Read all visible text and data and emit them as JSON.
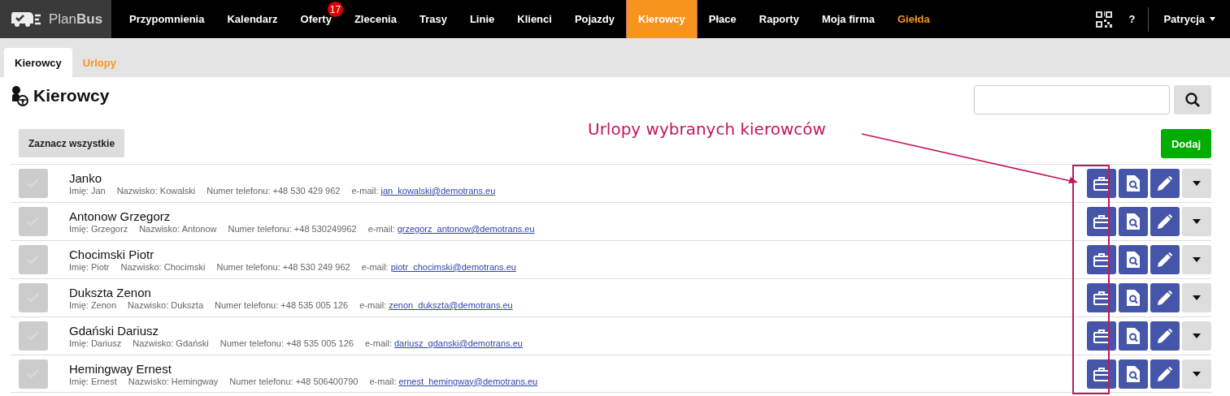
{
  "brand": {
    "name_light": "Plan",
    "name_bold": "Bus"
  },
  "nav": [
    {
      "label": "Przypomnienia",
      "selected": false,
      "accent": false
    },
    {
      "label": "Kalendarz",
      "selected": false,
      "accent": false
    },
    {
      "label": "Oferty",
      "selected": false,
      "accent": false,
      "badge": "17"
    },
    {
      "label": "Zlecenia",
      "selected": false,
      "accent": false
    },
    {
      "label": "Trasy",
      "selected": false,
      "accent": false
    },
    {
      "label": "Linie",
      "selected": false,
      "accent": false
    },
    {
      "label": "Klienci",
      "selected": false,
      "accent": false
    },
    {
      "label": "Pojazdy",
      "selected": false,
      "accent": false
    },
    {
      "label": "Kierowcy",
      "selected": true,
      "accent": false
    },
    {
      "label": "Płace",
      "selected": false,
      "accent": false
    },
    {
      "label": "Raporty",
      "selected": false,
      "accent": false
    },
    {
      "label": "Moja firma",
      "selected": false,
      "accent": false
    },
    {
      "label": "Giełda",
      "selected": false,
      "accent": true
    }
  ],
  "help": "?",
  "user": "Patrycja",
  "tabs": [
    {
      "label": "Kierowcy",
      "selected": true
    },
    {
      "label": "Urlopy",
      "selected": false
    }
  ],
  "page_title": "Kierowcy",
  "select_all": "Zaznacz wszystkie",
  "add": "Dodaj",
  "annotation": "Urlopy wybranych kierowców",
  "drivers": [
    {
      "name": "Janko",
      "first": "Imię: Jan",
      "last": "Nazwisko: Kowalski",
      "phone": "Numer telefonu: +48 530 429 962",
      "email_label": "e-mail:",
      "email": "jan_kowalski@demotrans.eu",
      "checked": false
    },
    {
      "name": "Antonow Grzegorz",
      "first": "Imię: Grzegorz",
      "last": "Nazwisko: Antonow",
      "phone": "Numer telefonu: +48 530249962",
      "email_label": "e-mail:",
      "email": "grzegorz_antonow@demotrans.eu",
      "checked": false
    },
    {
      "name": "Chocimski Piotr",
      "first": "Imię: Piotr",
      "last": "Nazwisko: Chocimski",
      "phone": "Numer telefonu: +48 530 249 962",
      "email_label": "e-mail:",
      "email": "piotr_chocimski@demotrans.eu",
      "checked": false
    },
    {
      "name": "Dukszta Zenon",
      "first": "Imię: Zenon",
      "last": "Nazwisko: Dukszta",
      "phone": "Numer telefonu: +48 535 005 126",
      "email_label": "e-mail:",
      "email": "zenon_dukszta@demotrans.eu",
      "checked": false
    },
    {
      "name": "Gdański Dariusz",
      "first": "Imię: Dariusz",
      "last": "Nazwisko: Gdański",
      "phone": "Numer telefonu: +48 535 005 126",
      "email_label": "e-mail:",
      "email": "dariusz_gdanski@demotrans.eu",
      "checked": false
    },
    {
      "name": "Hemingway Ernest",
      "first": "Imię: Ernest",
      "last": "Nazwisko: Hemingway",
      "phone": "Numer telefonu: +48 506400790",
      "email_label": "e-mail:",
      "email": "ernest_hemingway@demotrans.eu",
      "checked": false
    }
  ]
}
